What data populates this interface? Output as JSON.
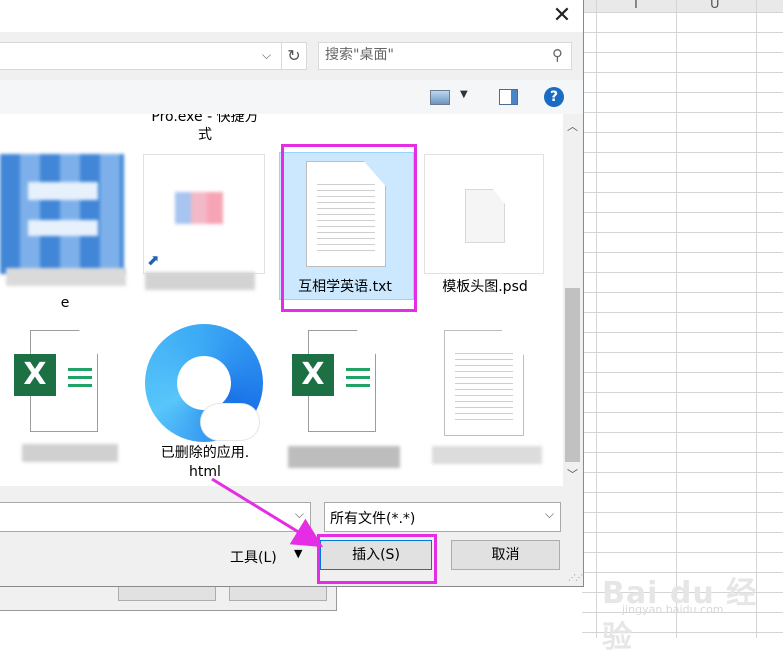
{
  "dialog": {
    "search_placeholder": "搜索\"桌面\"",
    "file_type_filter": "所有文件(*.*)",
    "tools_label": "工具(L)",
    "insert_label": "插入(S)",
    "cancel_label": "取消"
  },
  "files": [
    {
      "name": "Pro.exe - 快捷方式",
      "icon": "shortcut-icon",
      "visible_label": [
        "Pro.exe - 快捷方",
        "式"
      ]
    },
    {
      "name": "互相学英语.txt",
      "icon": "text-file-icon",
      "selected": true
    },
    {
      "name": "模板头图.psd",
      "icon": "blank-file-icon"
    },
    {
      "name": "已删除的应用.html",
      "icon": "browser-icon",
      "visible_label": [
        "已删除的应用.",
        "html"
      ]
    },
    {
      "name": "e",
      "icon": "blurred-app-icon"
    }
  ],
  "sheet": {
    "col_headers": [
      "T",
      "U"
    ]
  },
  "watermark": {
    "text": "Bai du 经验",
    "sub": "jingyan.baidu.com"
  },
  "colors": {
    "highlight": "#e52de6",
    "accent": "#0078d7",
    "excel_green": "#1d7044"
  }
}
